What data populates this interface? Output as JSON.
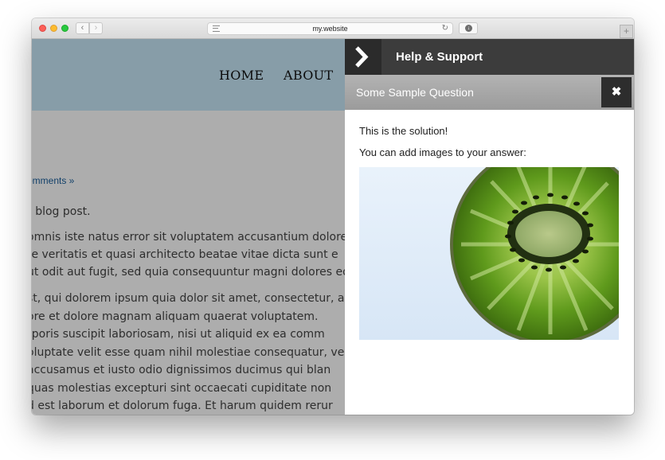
{
  "browser": {
    "url": "my.website",
    "icons": {
      "back": "chevron-left-icon",
      "forward": "chevron-right-icon",
      "reader": "reader-icon",
      "reload": "reload-icon",
      "download": "download-icon",
      "new_tab": "plus-icon"
    },
    "back_glyph": "‹",
    "forward_glyph": "›",
    "reload_glyph": "↻",
    "download_glyph": "↓",
    "new_tab_glyph": "+"
  },
  "site": {
    "nav": {
      "home": "HOME",
      "about": "ABOUT"
    },
    "comments_link": "omments »",
    "post_lines": [
      "r blog post.",
      "omnis iste natus error sit voluptatem accusantium dolore",
      "re veritatis et quasi architecto beatae vitae dicta sunt e",
      "ut odit aut fugit, sed quia consequuntur magni dolores eos",
      "st, qui dolorem ipsum quia dolor sit amet, consectetur, a",
      "ore et dolore magnam aliquam quaerat voluptatem.",
      "rporis suscipit laboriosam, nisi ut aliquid ex ea comm",
      "oluptate velit esse quam nihil molestiae consequatur, vel il",
      " accusamus et iusto odio dignissimos ducimus qui blan",
      " quas molestias excepturi sint occaecati cupiditate non",
      "d est laborum et dolorum fuga. Et harum quidem rerur"
    ]
  },
  "panel": {
    "title": "Help & Support",
    "toggle_icon": "chevron-right-icon",
    "question": "Some Sample Question",
    "close_icon": "close-icon",
    "close_glyph": "✖",
    "answer": {
      "paragraphs": [
        "This is the solution!",
        "You can add images to your answer:"
      ],
      "image": "kiwi-slice-image"
    }
  },
  "colors": {
    "panel_header": "#3c3c3c",
    "question_bar": "#a6a6a6",
    "site_header": "#c7e7f8",
    "link": "#1a5f9c"
  }
}
